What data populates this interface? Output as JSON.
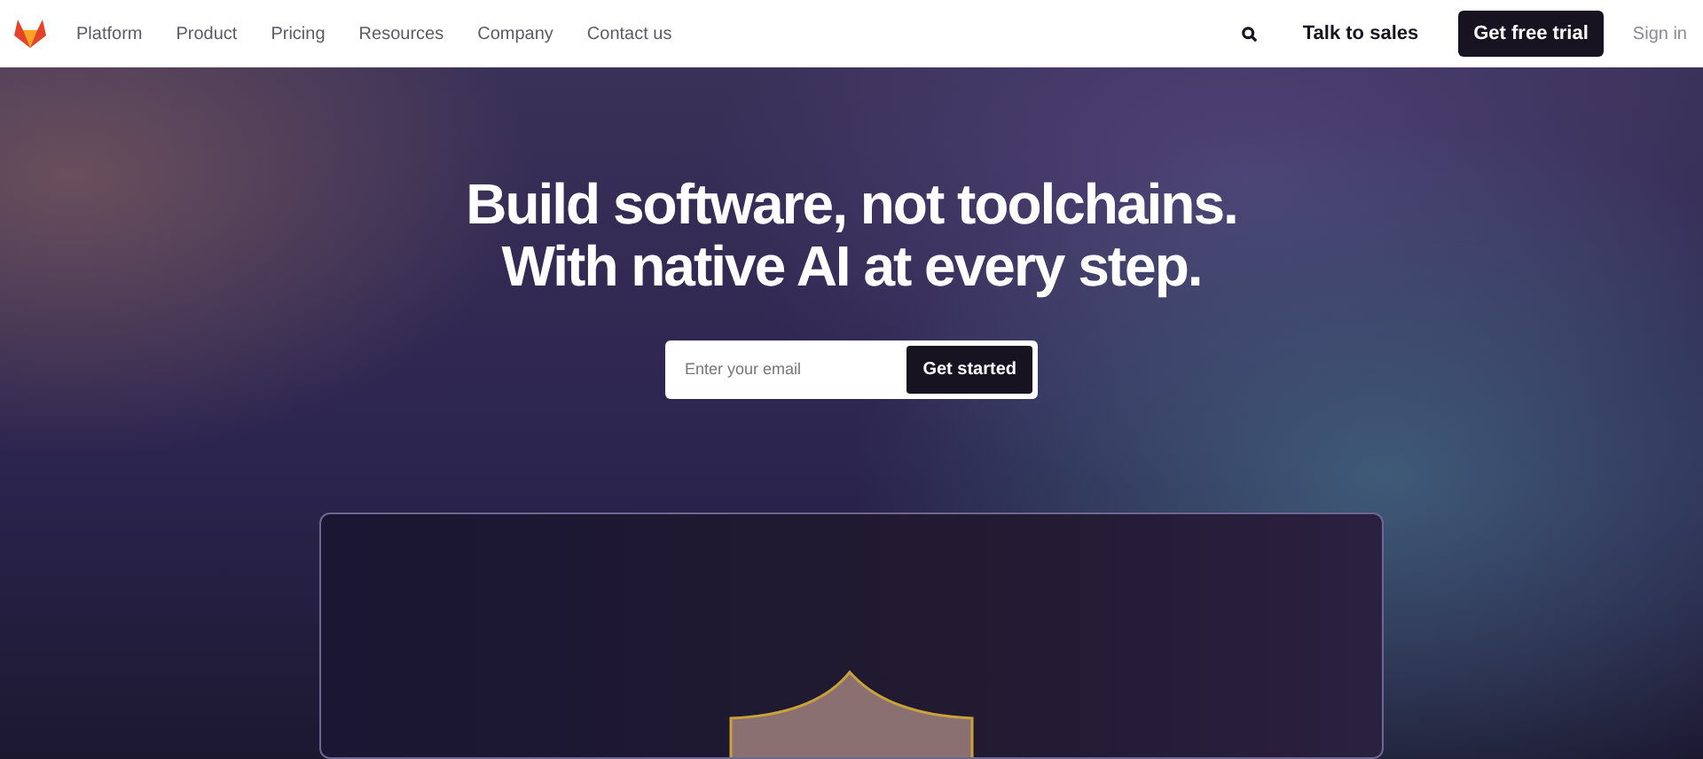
{
  "nav": {
    "links": [
      "Platform",
      "Product",
      "Pricing",
      "Resources",
      "Company",
      "Contact us"
    ],
    "talk_to_sales": "Talk to sales",
    "free_trial": "Get free trial",
    "sign_in": "Sign in"
  },
  "hero": {
    "headline": [
      "Build software, not toolchains.",
      "With native AI at every step."
    ],
    "email": {
      "placeholder": "Enter your email"
    },
    "cta": "Get started"
  }
}
